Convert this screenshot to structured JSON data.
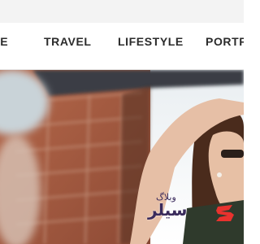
{
  "nav": {
    "items": [
      {
        "label": "ME"
      },
      {
        "label": "TRAVEL"
      },
      {
        "label": "LIFESTYLE"
      },
      {
        "label": "PORTFO"
      }
    ]
  },
  "hero": {
    "icon": "photo-hero"
  },
  "watermark": {
    "small_text": "وبلاگ",
    "main_text": "سیلر",
    "colors": {
      "text": "#3a2b5c",
      "logo": "#e8322e"
    }
  }
}
